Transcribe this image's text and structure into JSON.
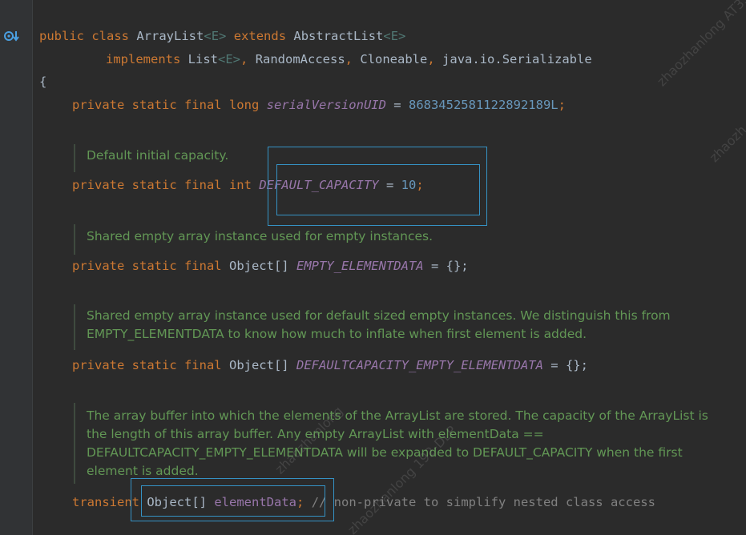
{
  "code": {
    "l1": {
      "kw1": "public",
      "kw2": "class",
      "name": "ArrayList",
      "gen": "<E>",
      "kw3": "extends",
      "sup": "AbstractList",
      "gen2": "<E>"
    },
    "l2": {
      "kw": "implements",
      "t1": "List",
      "gen": "<E>",
      "sep1": ",",
      "t2": "RandomAccess",
      "sep2": ",",
      "t3": "Cloneable",
      "sep3": ",",
      "t4": "java.io.Serializable"
    },
    "l3": {
      "brace": "{"
    },
    "l4": {
      "kw": "private static final long",
      "name": "serialVersionUID",
      "eq": "=",
      "val": "8683452581122892189L",
      "semi": ";"
    },
    "doc1": "Default initial capacity.",
    "l5": {
      "kw": "private static final int",
      "name": "DEFAULT_CAPACITY",
      "eq": "=",
      "val": "10",
      "semi": ";"
    },
    "doc2": "Shared empty array instance used for empty instances.",
    "l6": {
      "kw": "private static final",
      "type": "Object[]",
      "name": "EMPTY_ELEMENTDATA",
      "rest": "= {};"
    },
    "doc3": "Shared empty array instance used for default sized empty instances. We distinguish this from EMPTY_ELEMENTDATA to know how much to inflate when first element is added.",
    "l7": {
      "kw": "private static final",
      "type": "Object[]",
      "name": "DEFAULTCAPACITY_EMPTY_ELEMENTDATA",
      "rest": "= {};"
    },
    "doc4": "The array buffer into which the elements of the ArrayList are stored. The capacity of the ArrayList is the length of this array buffer. Any empty ArrayList with elementData == DEFAULTCAPACITY_EMPTY_ELEMENTDATA will be expanded to DEFAULT_CAPACITY when the first element is added.",
    "l8": {
      "kw": "transient",
      "type": "Object[]",
      "name": "elementData",
      "semi": ";",
      "comment": "// non-private to simplify nested class access"
    }
  },
  "watermarks": [
    "zhaozhanlong AT35",
    "zhaozhanlong",
    "zhaozhanlong 192-DLP",
    "zhaozh"
  ],
  "colors": {
    "bg": "#2b2b2b",
    "keyword": "#cc7832",
    "doc": "#629755",
    "constant": "#9876aa",
    "number": "#6897bb",
    "highlight": "#3592c4"
  }
}
